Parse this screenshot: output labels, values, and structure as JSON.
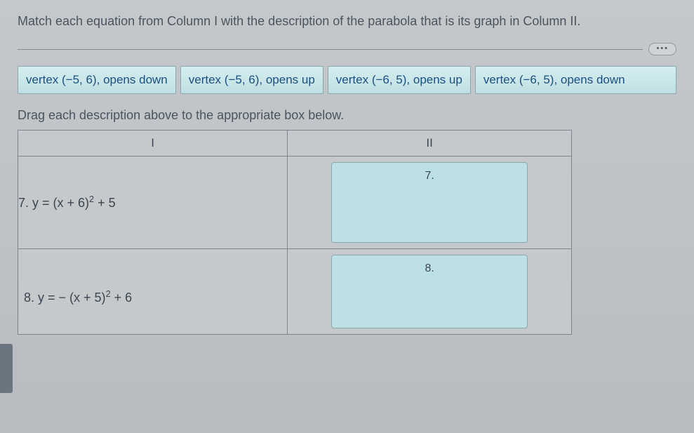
{
  "instructions": "Match each equation from Column I with the description of the parabola that is its graph in Column II.",
  "ellipsis": "•••",
  "options": {
    "opt1": "vertex (−5, 6), opens down",
    "opt2": "vertex (−5, 6), opens up",
    "opt3": "vertex (−6, 5), opens up",
    "opt4": "vertex (−6, 5), opens down"
  },
  "drag_instructions": "Drag each description above to the appropriate box below.",
  "headers": {
    "col1": "I",
    "col2": "II"
  },
  "rows": {
    "r7": {
      "num": "7.",
      "eq_pre": " y = (x + 6)",
      "eq_exp": "2",
      "eq_post": " + 5",
      "drop_label": "7."
    },
    "r8": {
      "num": "8.",
      "eq_pre": " y = − (x + 5)",
      "eq_exp": "2",
      "eq_post": " + 6",
      "drop_label": "8."
    }
  }
}
